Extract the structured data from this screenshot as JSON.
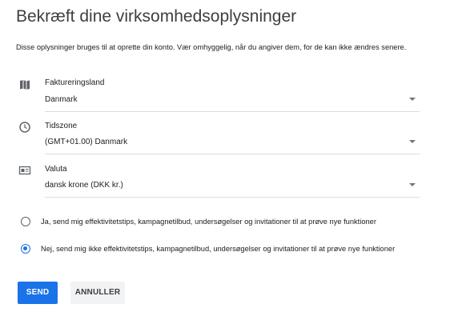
{
  "page_title": "Bekræft dine virksomhedsoplysninger",
  "intro_text": "Disse oplysninger bruges til at oprette din konto. Vær omhyggelig, når du angiver dem, for de kan ikke ændres senere.",
  "fields": [
    {
      "label": "Faktureringsland",
      "value": "Danmark",
      "icon": "map-icon"
    },
    {
      "label": "Tidszone",
      "value": "(GMT+01.00) Danmark",
      "icon": "clock-icon"
    },
    {
      "label": "Valuta",
      "value": "dansk krone (DKK kr.)",
      "icon": "currency-icon"
    }
  ],
  "email_options": [
    {
      "label": "Ja, send mig effektivitetstips, kampagnetilbud, undersøgelser og invitationer til at prøve nye funktioner",
      "selected": false
    },
    {
      "label": "Nej, send mig ikke effektivitetstips, kampagnetilbud, undersøgelser og invitationer til at prøve nye funktioner",
      "selected": true
    }
  ],
  "buttons": {
    "send": "SEND",
    "cancel": "ANNULLER"
  },
  "colors": {
    "accent": "#1a73e8",
    "icon": "#5f6368",
    "divider": "#dadce0"
  }
}
